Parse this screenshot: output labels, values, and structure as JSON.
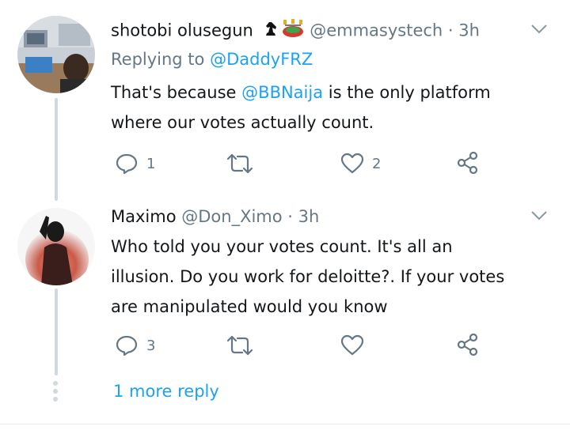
{
  "tweets": [
    {
      "name": "shotobi olusegun",
      "handle": "@emmasystech",
      "separator": "·",
      "time": "3h",
      "reply_prefix": "Replying to",
      "reply_handle": "@DaddyFRZ",
      "text_part1": "That's because",
      "mention": "@BBNaija",
      "text_part2": " is the only platform",
      "text_line2": "where our votes actually count.",
      "emoji_icons": [
        "chess-knight-icon",
        "stadium-icon"
      ],
      "reply_count": "1",
      "retweet_count": "",
      "like_count": "2"
    },
    {
      "name": "Maximo",
      "handle": "@Don_Ximo",
      "separator": "·",
      "time": "3h",
      "text_lines": [
        "Who told you your votes count. It's all an",
        "illusion. Do you work for deloitte?. If your votes",
        "are manipulated would you know"
      ],
      "reply_count": "3",
      "retweet_count": "",
      "like_count": ""
    }
  ],
  "more_replies": "1 more reply",
  "colors": {
    "accent": "#1da1f2",
    "muted": "#657786",
    "thread_line": "#cfd9de"
  }
}
